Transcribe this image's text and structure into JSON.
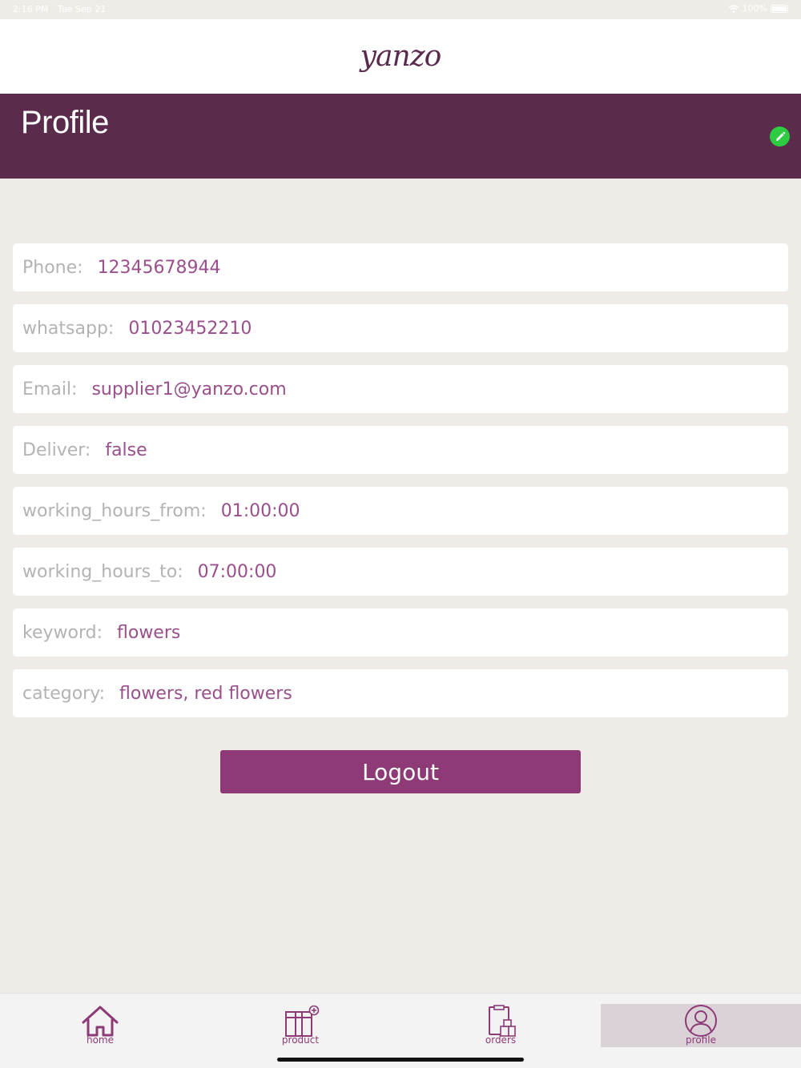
{
  "status_bar": {
    "time": "2:16 PM",
    "date": "Tue Sep 21",
    "battery": "100%"
  },
  "app": {
    "logo": "yanzo"
  },
  "header": {
    "title": "Profile"
  },
  "fields": [
    {
      "label": "Phone:",
      "value": "12345678944"
    },
    {
      "label": "whatsapp:",
      "value": "01023452210"
    },
    {
      "label": "Email:",
      "value": "supplier1@yanzo.com"
    },
    {
      "label": "Deliver:",
      "value": "false"
    },
    {
      "label": "working_hours_from:",
      "value": "01:00:00"
    },
    {
      "label": "working_hours_to:",
      "value": "07:00:00"
    },
    {
      "label": "keyword:",
      "value": "flowers"
    },
    {
      "label": "category:",
      "value": "flowers, red flowers"
    }
  ],
  "logout_label": "Logout",
  "tabs": [
    {
      "label": "home",
      "icon": "home-icon"
    },
    {
      "label": "product",
      "icon": "product-icon"
    },
    {
      "label": "orders",
      "icon": "orders-icon"
    },
    {
      "label": "profile",
      "icon": "profile-icon",
      "active": true
    }
  ],
  "colors": {
    "header": "#5b2b4c",
    "accent": "#8d3a77",
    "value_text": "#9a4f8c",
    "edit_button": "#2ecc40",
    "background": "#efece8"
  }
}
